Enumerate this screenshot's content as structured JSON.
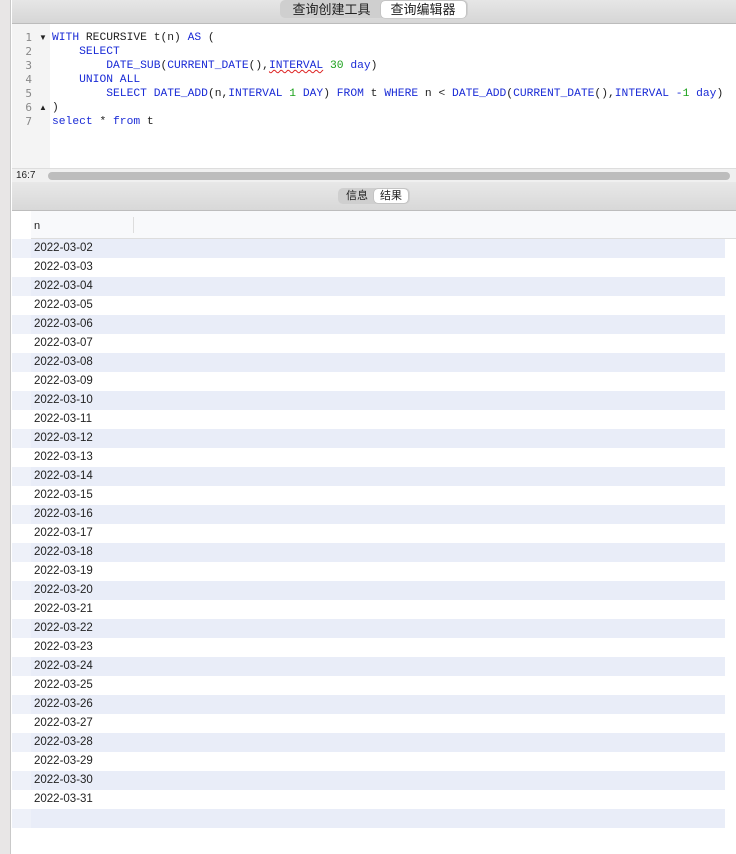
{
  "toolbar": {
    "tabs": [
      {
        "label": "查询创建工具",
        "active": false
      },
      {
        "label": "查询编辑器",
        "active": true
      }
    ]
  },
  "editor": {
    "lines": [
      {
        "num": "1",
        "fold": "▼",
        "html": "<span class='k'>WITH</span> RECURSIVE t(n) <span class='k'>AS</span> ("
      },
      {
        "num": "2",
        "fold": "",
        "html": "    <span class='k'>SELECT</span>"
      },
      {
        "num": "3",
        "fold": "",
        "html": "        <span class='k'>DATE_SUB</span>(<span class='k'>CURRENT_DATE</span>(),<span class='k u'>INTERVAL</span> <span class='n'>30</span> <span class='k'>day</span>)"
      },
      {
        "num": "4",
        "fold": "",
        "html": "    <span class='k'>UNION ALL</span>"
      },
      {
        "num": "5",
        "fold": "",
        "html": "        <span class='k'>SELECT DATE_ADD</span>(n,<span class='k'>INTERVAL</span> <span class='n'>1</span> <span class='k'>DAY</span>) <span class='k'>FROM</span> t <span class='k'>WHERE</span> n &lt; <span class='k'>DATE_ADD</span>(<span class='k'>CURRENT_DATE</span>(),<span class='k'>INTERVAL</span> <span class='k'>-</span><span class='n'>1</span> <span class='k'>day</span>)"
      },
      {
        "num": "6",
        "fold": "▲",
        "html": ")"
      },
      {
        "num": "7",
        "fold": "",
        "html": "<span class='k'>select</span> * <span class='k'>from</span> t"
      }
    ]
  },
  "status": {
    "cursor": "16:7"
  },
  "results_tabs": [
    {
      "label": "信息",
      "active": false
    },
    {
      "label": "结果",
      "active": true
    }
  ],
  "table": {
    "columns": [
      "n"
    ],
    "rows": [
      "2022-03-02",
      "2022-03-03",
      "2022-03-04",
      "2022-03-05",
      "2022-03-06",
      "2022-03-07",
      "2022-03-08",
      "2022-03-09",
      "2022-03-10",
      "2022-03-11",
      "2022-03-12",
      "2022-03-13",
      "2022-03-14",
      "2022-03-15",
      "2022-03-16",
      "2022-03-17",
      "2022-03-18",
      "2022-03-19",
      "2022-03-20",
      "2022-03-21",
      "2022-03-22",
      "2022-03-23",
      "2022-03-24",
      "2022-03-25",
      "2022-03-26",
      "2022-03-27",
      "2022-03-28",
      "2022-03-29",
      "2022-03-30",
      "2022-03-31"
    ]
  }
}
